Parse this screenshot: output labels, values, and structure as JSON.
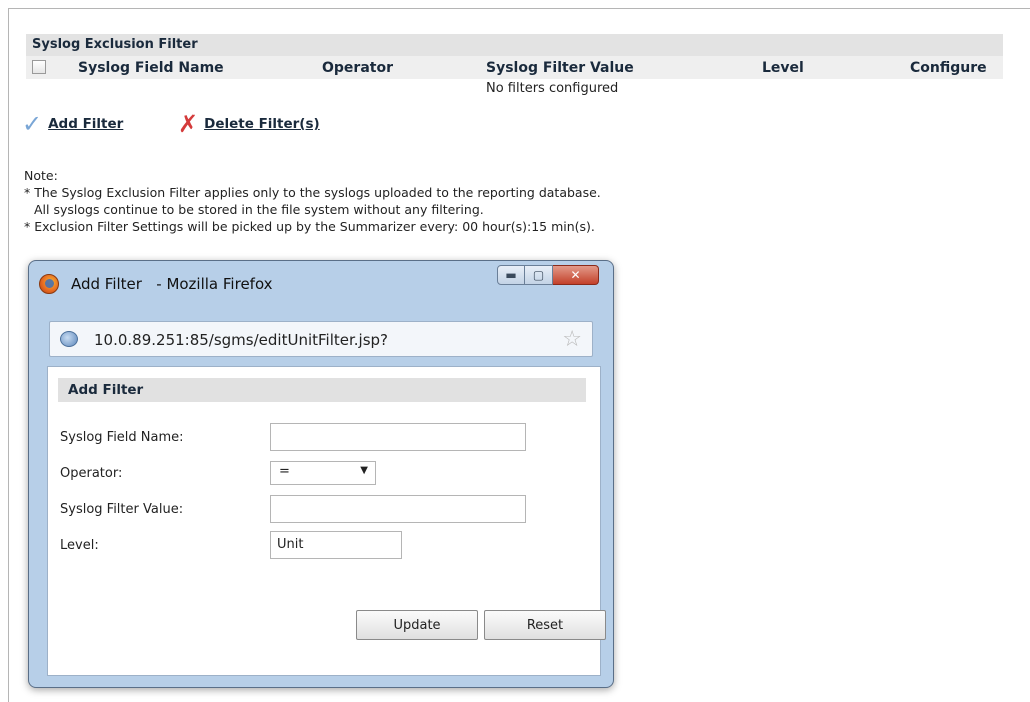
{
  "table": {
    "title": "Syslog Exclusion Filter",
    "columns": [
      "Syslog Field Name",
      "Operator",
      "Syslog Filter Value",
      "Level",
      "Configure"
    ],
    "empty_message": "No filters configured"
  },
  "actions": {
    "add_filter": "Add Filter",
    "delete_filter": "Delete Filter(s)"
  },
  "notes": {
    "heading": "Note:",
    "lines": [
      "* The Syslog Exclusion Filter applies only to the syslogs uploaded to the reporting database.",
      "All syslogs continue to be stored in the file system without any filtering.",
      "* Exclusion Filter Settings will be picked up by the Summarizer every: 00 hour(s):15 min(s)."
    ]
  },
  "popup": {
    "window_title": "Add Filter   - Mozilla Firefox",
    "url": "10.0.89.251:85/sgms/editUnitFilter.jsp?",
    "form_title": "Add Filter",
    "fields": {
      "field_name_label": "Syslog Field Name:",
      "field_name_value": "",
      "operator_label": "Operator:",
      "operator_value": "=",
      "filter_value_label": "Syslog Filter Value:",
      "filter_value_value": "",
      "level_label": "Level:",
      "level_value": "Unit"
    },
    "buttons": {
      "update": "Update",
      "reset": "Reset"
    }
  }
}
